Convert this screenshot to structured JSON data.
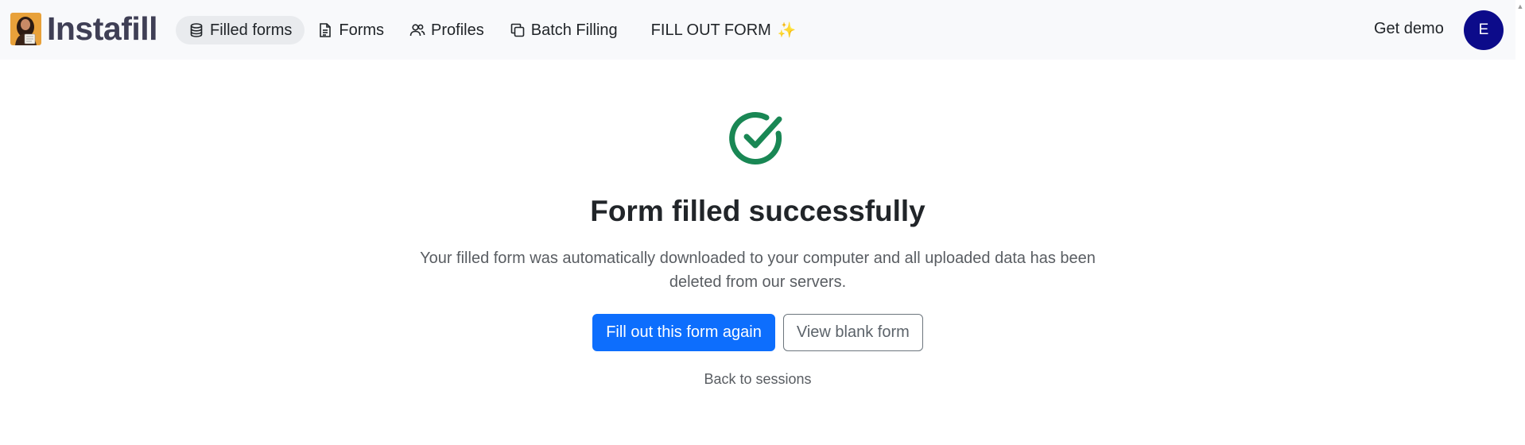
{
  "brand": {
    "name": "Instafill",
    "logo_icon": "woman-holding-form-logo"
  },
  "nav": {
    "items": [
      {
        "label": "Filled forms",
        "icon": "database-icon",
        "active": true
      },
      {
        "label": "Forms",
        "icon": "document-icon",
        "active": false
      },
      {
        "label": "Profiles",
        "icon": "people-icon",
        "active": false
      },
      {
        "label": "Batch Filling",
        "icon": "copy-icon",
        "active": false
      }
    ],
    "fill_out": {
      "label": "FILL OUT FORM",
      "sparkle": "✨"
    },
    "get_demo": "Get demo",
    "avatar_initial": "E"
  },
  "main": {
    "title": "Form filled successfully",
    "description": "Your filled form was automatically downloaded to your computer and all uploaded data has been deleted from our servers.",
    "primary_button": "Fill out this form again",
    "secondary_button": "View blank form",
    "back_link": "Back to sessions"
  },
  "colors": {
    "success": "#198754",
    "primary": "#0d6efd",
    "avatar_bg": "#0c0b8a",
    "navbar_bg": "#f8f9fb"
  }
}
